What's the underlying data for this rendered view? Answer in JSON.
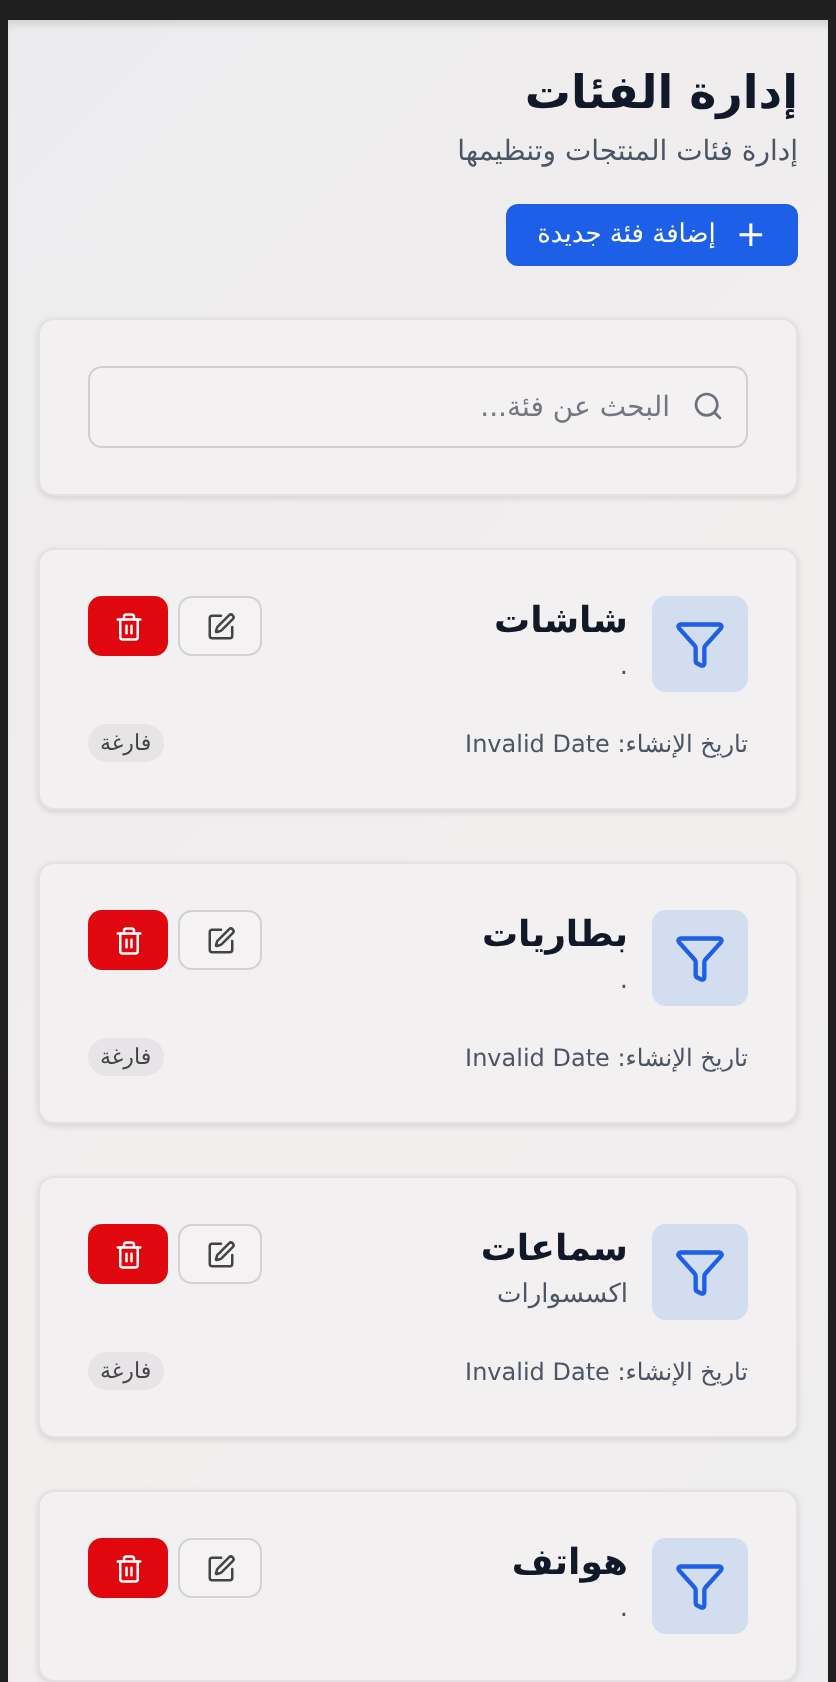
{
  "header": {
    "title": "إدارة الفئات",
    "subtitle": "إدارة فئات المنتجات وتنظيمها",
    "add_button": {
      "icon": "+",
      "label": "إضافة فئة جديدة"
    }
  },
  "search": {
    "placeholder": "البحث عن فئة..."
  },
  "categories": [
    {
      "name": "شاشات",
      "description": ".",
      "created": "تاريخ الإنشاء: Invalid Date",
      "status": "فارغة"
    },
    {
      "name": "بطاريات",
      "description": ".",
      "created": "تاريخ الإنشاء: Invalid Date",
      "status": "فارغة"
    },
    {
      "name": "سماعات",
      "description": "اكسسوارات",
      "created": "تاريخ الإنشاء: Invalid Date",
      "status": "فارغة"
    },
    {
      "name": "هواتف",
      "description": "."
    }
  ]
}
